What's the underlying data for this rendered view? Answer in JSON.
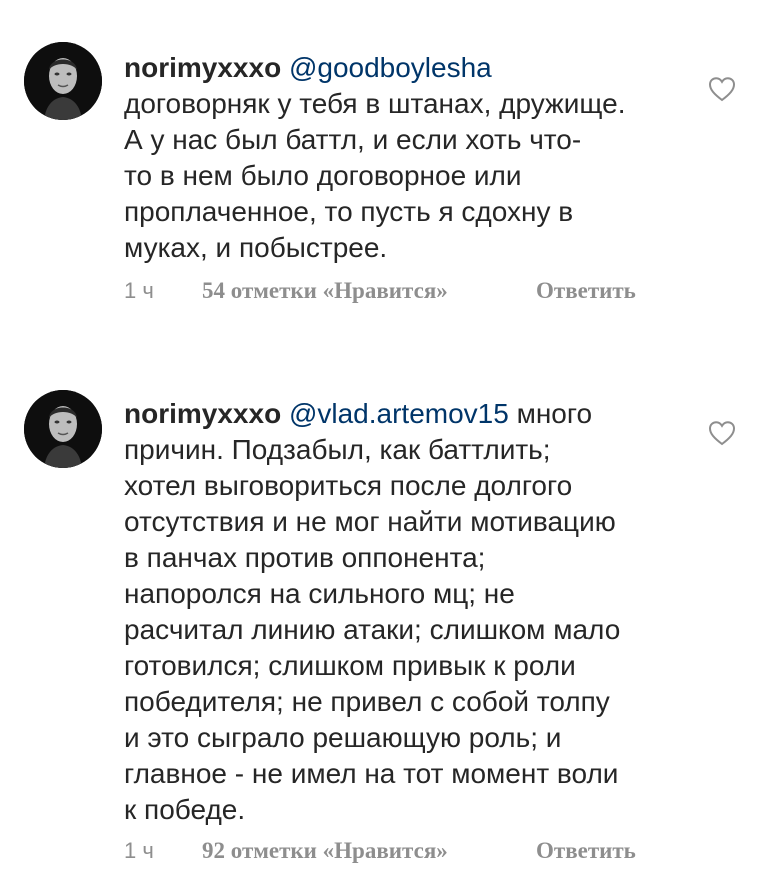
{
  "comments": [
    {
      "username": "norimyxxxo",
      "mention": "@goodboylesha",
      "lines": [
        "договорняк у тебя в штанах, дружище.",
        "А у нас был баттл, и если хоть что-",
        "то в нем было договорное или",
        "проплаченное, то пусть я сдохну в",
        "муках, и побыстрее."
      ],
      "time": "1 ч",
      "likes": "54 отметки «Нравится»",
      "reply_label": "Ответить"
    },
    {
      "username": "norimyxxxo",
      "mention": "@vlad.artemov15",
      "first_line_rest": " много",
      "lines": [
        "причин. Подзабыл, как баттлить;",
        "хотел выговориться после долгого",
        "отсутствия и не мог найти мотивацию",
        "в панчах против оппонента;",
        "напоролся на сильного мц; не",
        "расчитал линию атаки; слишком мало",
        "готовился; слишком привык к роли",
        "победителя; не привел с собой толпу",
        "и это сыграло решающую роль; и",
        "главное - не имел на тот момент воли",
        "к победе."
      ],
      "time": "1 ч",
      "likes": "92 отметки «Нравится»",
      "reply_label": "Ответить"
    }
  ],
  "icons": {
    "avatar": "avatar-photo",
    "like": "heart-outline-icon"
  },
  "colors": {
    "text": "#262626",
    "mention": "#003569",
    "meta": "#8e8e8e",
    "icon": "#8e8e8e"
  }
}
